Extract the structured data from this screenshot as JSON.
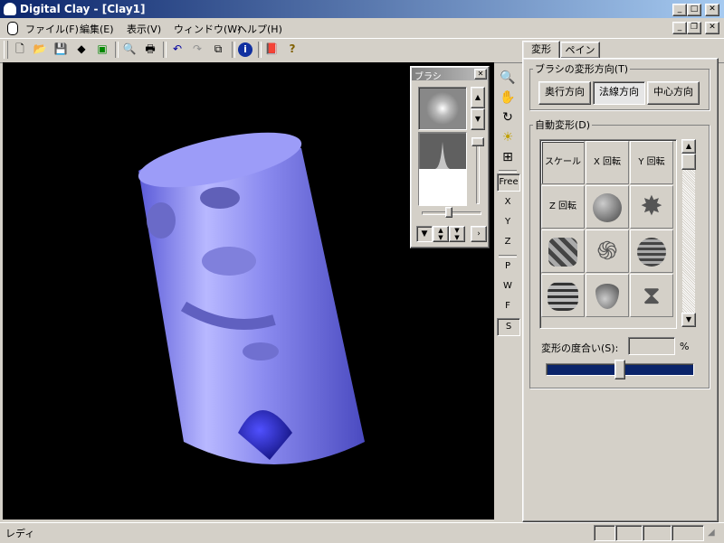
{
  "window": {
    "title": "Digital Clay - [Clay1]",
    "min": "_",
    "max": "□",
    "close": "✕"
  },
  "menu": {
    "items": [
      "ファイル(F)",
      "編集(E)",
      "表示(V)",
      "ウィンドウ(W)",
      "ヘルプ(H)"
    ]
  },
  "toolbar": {
    "new_icon": "new-document-icon",
    "open_icon": "open-folder-icon",
    "save_icon": "save-disk-icon"
  },
  "brush_panel": {
    "title": "ブラシ",
    "close": "✕"
  },
  "view_tools": {
    "labels": [
      "Free",
      "X",
      "Y",
      "Z",
      "P",
      "W",
      "F",
      "S"
    ]
  },
  "tabs": {
    "deform": "変形",
    "paint": "ペイント"
  },
  "deform": {
    "direction_label": "ブラシの変形方向(T)",
    "directions": [
      "奥行方向",
      "法線方向",
      "中心方向"
    ],
    "auto_label": "自動変形(D)",
    "grid_text": [
      "スケール",
      "X 回転",
      "Y 回転",
      "Z 回転"
    ],
    "degree_label": "変形の度合い(S):",
    "degree_value": "",
    "degree_unit": "%",
    "degree_fraction": 0.5
  },
  "status": {
    "text": "レディ"
  }
}
